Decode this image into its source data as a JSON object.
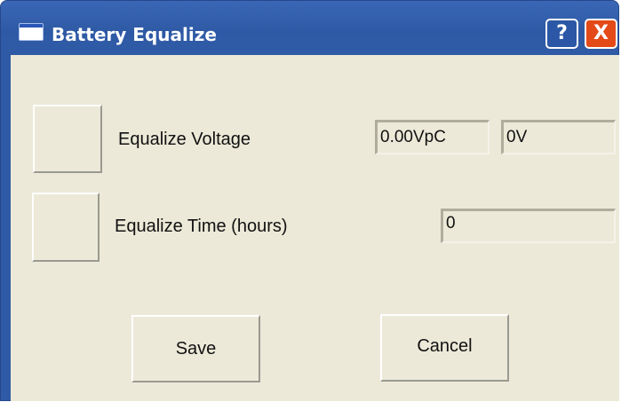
{
  "window": {
    "title": "Battery Equalize",
    "help_label": "?",
    "close_label": "X"
  },
  "equalize_voltage": {
    "label": "Equalize Voltage",
    "per_cell_value": "0.00VpC",
    "total_value": "0V"
  },
  "equalize_time": {
    "label": "Equalize Time (hours)",
    "value": "0"
  },
  "actions": {
    "save_label": "Save",
    "cancel_label": "Cancel"
  },
  "colors": {
    "titlebar": "#2f5aa6",
    "close_button": "#e44a18",
    "client_background": "#ece9d8"
  },
  "icons": [
    "window-icon",
    "help-icon",
    "close-icon"
  ]
}
